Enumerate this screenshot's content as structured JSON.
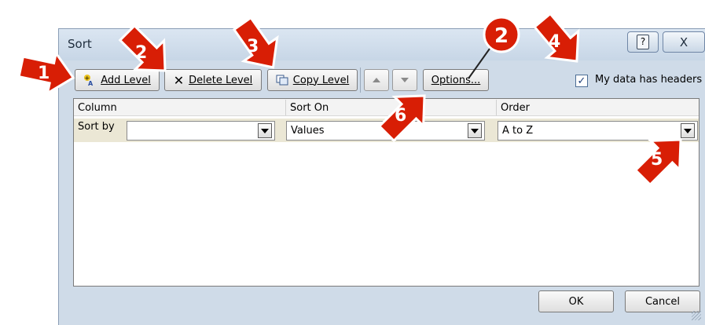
{
  "dialog": {
    "title": "Sort",
    "help_label": "?",
    "close_label": "X"
  },
  "toolbar": {
    "add_level": "Add Level",
    "delete_level": "Delete Level",
    "copy_level": "Copy Level",
    "options": "Options...",
    "headers_checkbox_label": "My data has headers",
    "headers_checked": true
  },
  "grid": {
    "headers": {
      "column": "Column",
      "sort_on": "Sort On",
      "order": "Order"
    },
    "rows": [
      {
        "label": "Sort by",
        "column_value": "",
        "sort_on": "Values",
        "order": "A to Z"
      }
    ]
  },
  "footer": {
    "ok": "OK",
    "cancel": "Cancel"
  },
  "annotations": {
    "callout_color": "#d81e05",
    "numbers": [
      "1",
      "2",
      "3",
      "4",
      "5",
      "6",
      "2"
    ]
  }
}
